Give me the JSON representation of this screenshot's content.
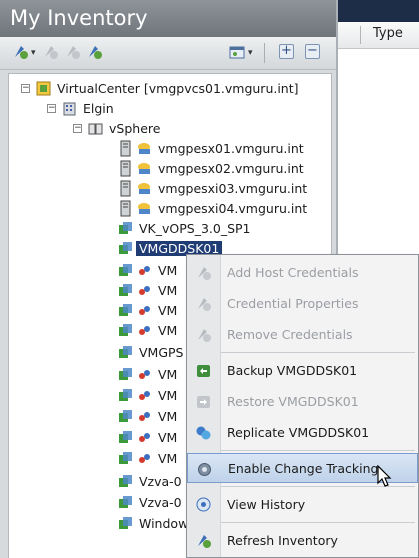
{
  "panel": {
    "title": "My Inventory"
  },
  "toolbar": {
    "icons": [
      "hosts-clusters-icon",
      "vms-templates-icon",
      "datastores-icon",
      "networks-icon"
    ],
    "view_icon": "view-options-icon",
    "expand_all": "+",
    "collapse_all": "−"
  },
  "tree": {
    "vc": "VirtualCenter [vmgpvcs01.vmguru.int]",
    "datacenter": "Elgin",
    "cluster": "vSphere",
    "hosts": [
      "vmgpesx01.vmguru.int",
      "vmgpesx02.vmguru.int",
      "vmgpesxi03.vmguru.int",
      "vmgpesxi04.vmguru.int"
    ],
    "vm1": "VK_vOPS_3.0_SP1",
    "selected_vm": "VMGDDSK01",
    "vm_partial": [
      "VM",
      "VM",
      "VM",
      "VM"
    ],
    "vm_gps": "VMGPS",
    "vm_partial2": [
      "VM",
      "VM",
      "VM",
      "VM",
      "VM"
    ],
    "vzva1": "Vzva-0",
    "vzva2": "Vzva-0",
    "windo": "Window"
  },
  "right": {
    "column_type": "Type"
  },
  "menu": {
    "items": [
      {
        "label": "Add Host Credentials",
        "icon": "credentials-icon",
        "enabled": false
      },
      {
        "label": "Credential Properties",
        "icon": "credentials-icon",
        "enabled": false
      },
      {
        "label": "Remove Credentials",
        "icon": "credentials-icon",
        "enabled": false
      },
      {
        "label": "Backup VMGDDSK01",
        "icon": "backup-icon",
        "enabled": true
      },
      {
        "label": "Restore VMGDDSK01",
        "icon": "restore-icon",
        "enabled": false
      },
      {
        "label": "Replicate VMGDDSK01",
        "icon": "replicate-icon",
        "enabled": true
      },
      {
        "label": "Enable Change Tracking",
        "icon": "change-tracking-icon",
        "enabled": true,
        "highlighted": true
      },
      {
        "label": "View History",
        "icon": "history-icon",
        "enabled": true
      },
      {
        "label": "Refresh Inventory",
        "icon": "refresh-icon",
        "enabled": true
      }
    ]
  },
  "colors": {
    "selection": "#1f3c75",
    "menu_hover": "#bfd2ea",
    "title_bar": "#7c8288"
  }
}
